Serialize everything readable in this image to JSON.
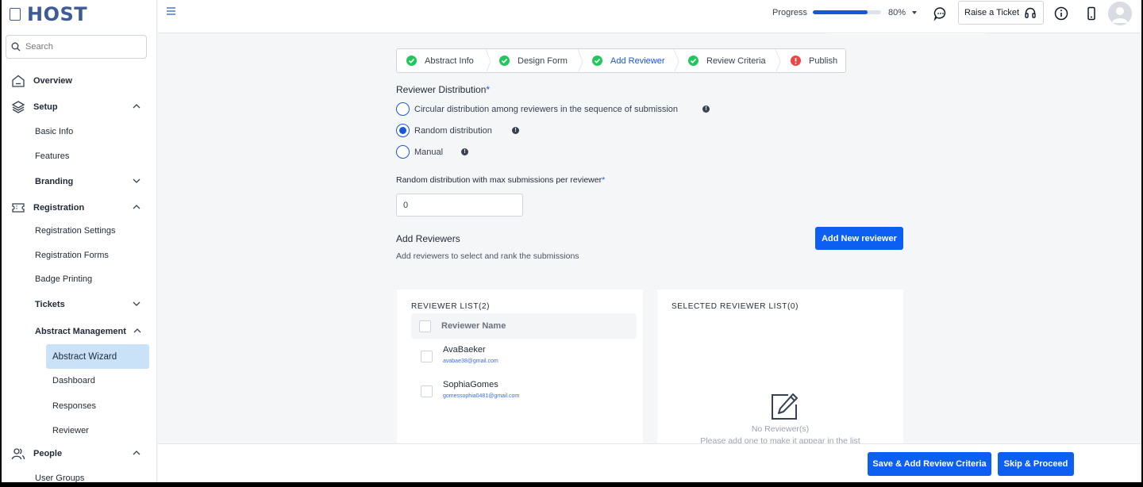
{
  "app": {
    "logo_text": "HOST"
  },
  "search": {
    "placeholder": "Search"
  },
  "sidebar": {
    "overview": "Overview",
    "setup": "Setup",
    "basic_info": "Basic Info",
    "features": "Features",
    "branding": "Branding",
    "registration": "Registration",
    "registration_settings": "Registration Settings",
    "registration_forms": "Registration Forms",
    "badge_printing": "Badge Printing",
    "tickets": "Tickets",
    "abstract_management": "Abstract Management",
    "abstract_wizard": "Abstract Wizard",
    "dashboard": "Dashboard",
    "responses": "Responses",
    "reviewer": "Reviewer",
    "people": "People",
    "user_groups": "User Groups"
  },
  "topbar": {
    "progress_label": "Progress",
    "progress_value": 0.8,
    "progress_text": "80%",
    "ticket_label": "Raise a Ticket"
  },
  "stepper": {
    "steps": [
      {
        "label": "Abstract Info",
        "status": "done"
      },
      {
        "label": "Design Form",
        "status": "done"
      },
      {
        "label": "Add Reviewer",
        "status": "current"
      },
      {
        "label": "Review Criteria",
        "status": "done"
      },
      {
        "label": "Publish",
        "status": "error"
      }
    ]
  },
  "distribution": {
    "title": "Reviewer Distribution",
    "required_mark": "*",
    "options": [
      "Circular distribution among reviewers in the sequence of submission",
      "Random distribution",
      "Manual"
    ],
    "selected_option": "Random distribution",
    "max_label": "Random distribution with max submissions per reviewer",
    "max_value": "0"
  },
  "reviewers": {
    "title": "Add Reviewers",
    "subtitle": "Add reviewers to select and rank the submissions",
    "add_button": "Add New reviewer",
    "list_title": "REVIEWER LIST(2)",
    "column_header": "Reviewer Name",
    "items": [
      {
        "name": "AvaBaeker",
        "email": "avabae38@gmail.com"
      },
      {
        "name": "SophiaGomes",
        "email": "gomessophia0481@gmail.com"
      }
    ],
    "selected_title": "SELECTED REVIEWER LIST(0)",
    "empty_title": "No Reviewer(s)",
    "empty_subtitle": "Please add one to make it appear in the list"
  },
  "footer": {
    "save_button": "Save & Add Review Criteria",
    "skip_button": "Skip & Proceed"
  },
  "colors": {
    "primary": "#0d5ef2",
    "success": "#22c55e",
    "error": "#ef4444",
    "active_nav_bg": "#c9e2f8",
    "logo": "#3d5a99"
  }
}
